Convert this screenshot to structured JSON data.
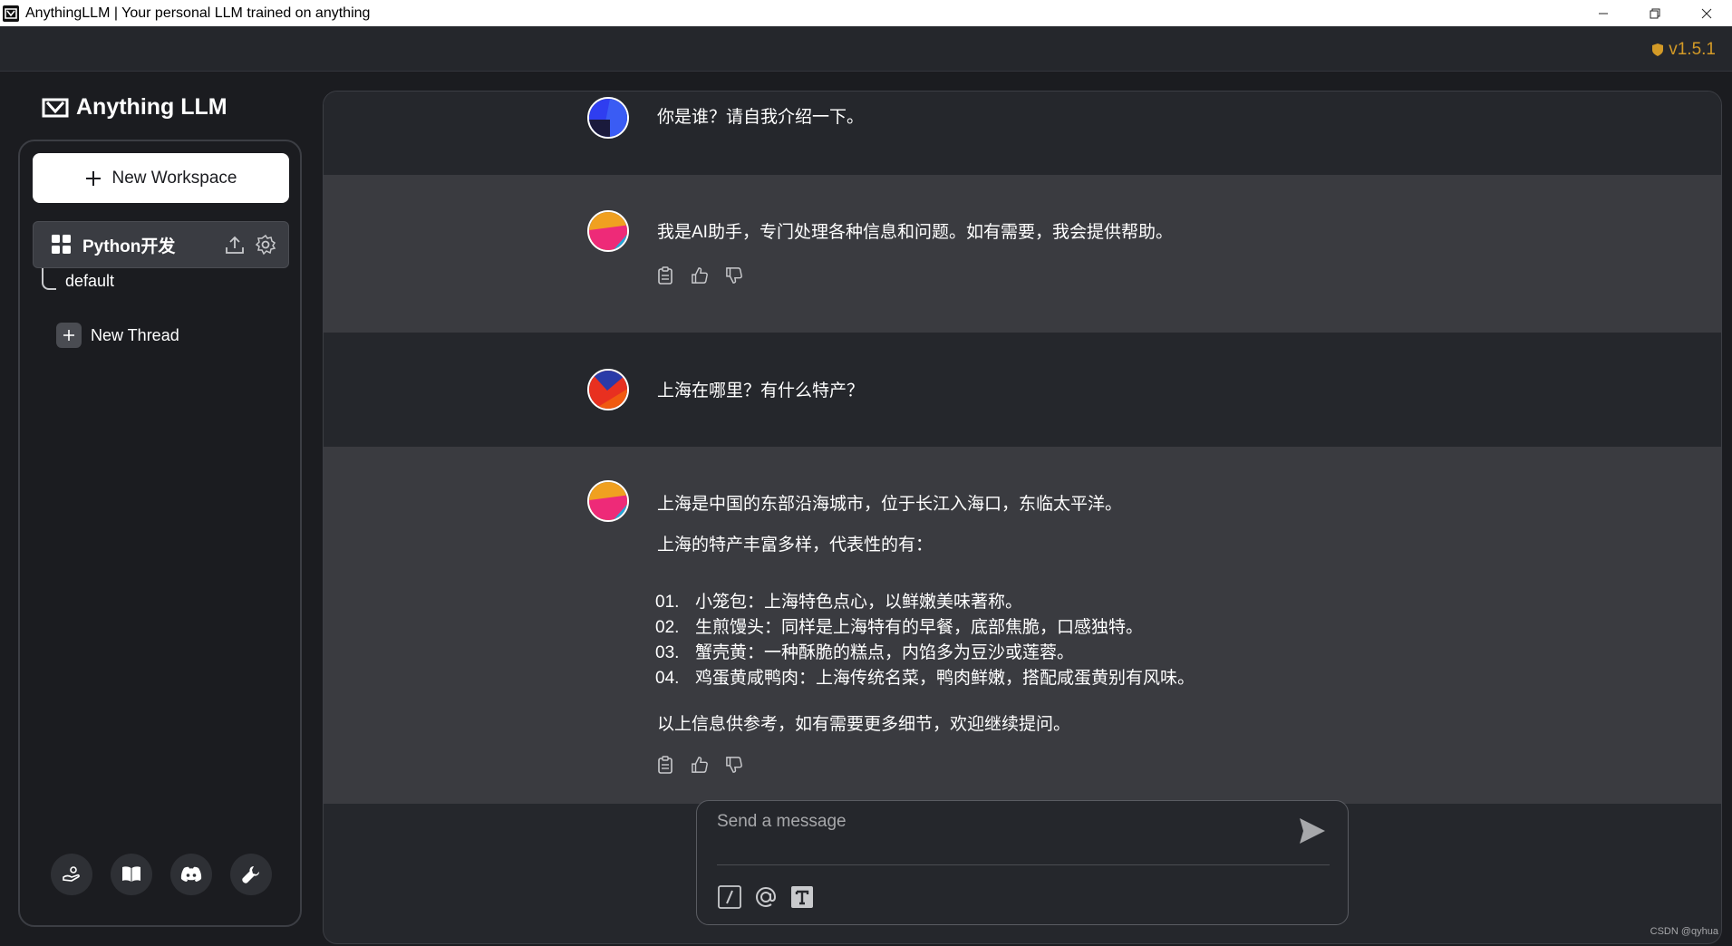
{
  "window": {
    "title": "AnythingLLM | Your personal LLM trained on anything"
  },
  "version": "v1.5.1",
  "logo": {
    "text": "Anything LLM"
  },
  "sidebar": {
    "new_workspace_label": "New Workspace",
    "workspace": {
      "name": "Python开发"
    },
    "threads": [
      {
        "label": "default"
      }
    ],
    "new_thread_label": "New Thread",
    "footer_icons": [
      "support-icon",
      "docs-icon",
      "discord-icon",
      "settings-wrench-icon"
    ]
  },
  "chat": {
    "messages": [
      {
        "role": "user",
        "text": "你是谁？请自我介绍一下。"
      },
      {
        "role": "assistant",
        "text": "我是AI助手，专门处理各种信息和问题。如有需要，我会提供帮助。"
      },
      {
        "role": "user",
        "text": "上海在哪里？有什么特产？"
      },
      {
        "role": "assistant",
        "intro": "上海是中国的东部沿海城市，位于长江入海口，东临太平洋。",
        "subtitle": "上海的特产丰富多样，代表性的有：",
        "list": [
          {
            "num": "01.",
            "text": "小笼包：上海特色点心，以鲜嫩美味著称。"
          },
          {
            "num": "02.",
            "text": "生煎馒头：同样是上海特有的早餐，底部焦脆，口感独特。"
          },
          {
            "num": "03.",
            "text": "蟹壳黄：一种酥脆的糕点，内馅多为豆沙或莲蓉。"
          },
          {
            "num": "04.",
            "text": "鸡蛋黄咸鸭肉：上海传统名菜，鸭肉鲜嫩，搭配咸蛋黄别有风味。"
          }
        ],
        "closing": "以上信息供参考，如有需要更多细节，欢迎继续提问。"
      }
    ]
  },
  "input": {
    "placeholder": "Send a message"
  },
  "watermark": "CSDN @qyhua",
  "colors": {
    "accent_version": "#d39a27",
    "background": "#1b1c20",
    "panel": "#25272c",
    "ai_row": "#3a3b40"
  }
}
